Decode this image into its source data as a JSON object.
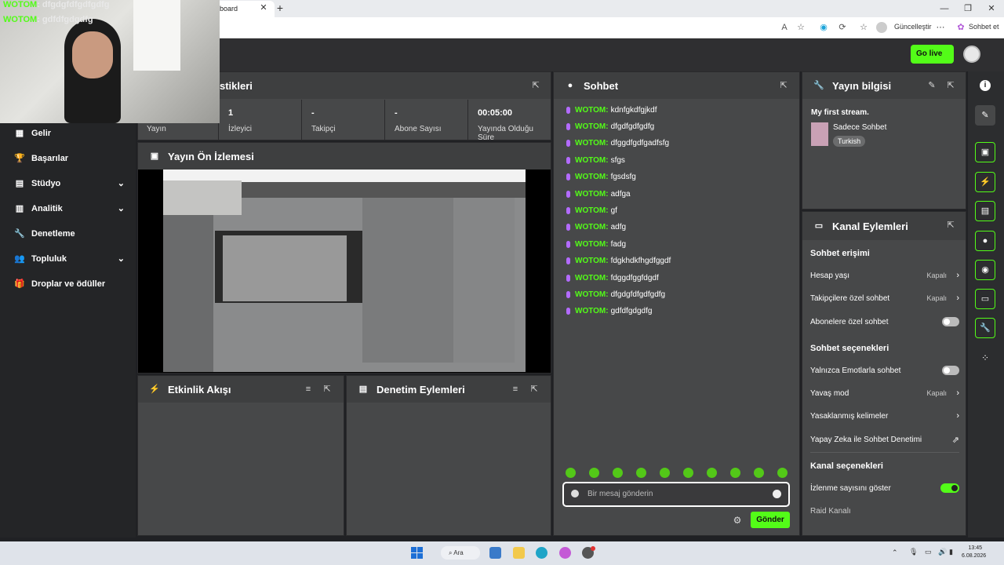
{
  "browser": {
    "tab_title": "board",
    "update_label": "Güncelleştir",
    "chat_label": "Sohbet et"
  },
  "header": {
    "golive_label": "Go live"
  },
  "sidebar": {
    "items": [
      {
        "label": "Gelir",
        "icon": "money-icon",
        "chevron": false
      },
      {
        "label": "Başarılar",
        "icon": "trophy-icon",
        "chevron": false
      },
      {
        "label": "Stüdyo",
        "icon": "studio-icon",
        "chevron": true
      },
      {
        "label": "Analitik",
        "icon": "analytics-icon",
        "chevron": true
      },
      {
        "label": "Denetleme",
        "icon": "wrench-icon",
        "chevron": false
      },
      {
        "label": "Topluluk",
        "icon": "community-icon",
        "chevron": true
      },
      {
        "label": "Droplar ve ödüller",
        "icon": "gift-icon",
        "chevron": false
      }
    ]
  },
  "stats": {
    "title": "stikleri",
    "cells": [
      {
        "value": "",
        "label": "Yayın"
      },
      {
        "value": "1",
        "label": "İzleyici"
      },
      {
        "value": "-",
        "label": "Takipçi"
      },
      {
        "value": "-",
        "label": "Abone Sayısı"
      },
      {
        "value": "00:05:00",
        "label": "Yayında Olduğu Süre"
      }
    ]
  },
  "preview": {
    "title": "Yayın Ön İzlemesi"
  },
  "activity": {
    "title": "Etkinlik Akışı"
  },
  "modlog": {
    "title": "Denetim Eylemleri"
  },
  "chat": {
    "title": "Sohbet",
    "messages": [
      {
        "user": "WOTOM:",
        "text": "kdnfgkdfgjkdf"
      },
      {
        "user": "WOTOM:",
        "text": "dfgdfgdfgdfg"
      },
      {
        "user": "WOTOM:",
        "text": "dfggdfgdfgadfsfg"
      },
      {
        "user": "WOTOM:",
        "text": "sfgs"
      },
      {
        "user": "WOTOM:",
        "text": "fgsdsfg"
      },
      {
        "user": "WOTOM:",
        "text": "adfga"
      },
      {
        "user": "WOTOM:",
        "text": "gf"
      },
      {
        "user": "WOTOM:",
        "text": "adfg"
      },
      {
        "user": "WOTOM:",
        "text": "fadg"
      },
      {
        "user": "WOTOM:",
        "text": "fdgkhdkfhgdfggdf"
      },
      {
        "user": "WOTOM:",
        "text": "fdggdfggfdgdf"
      },
      {
        "user": "WOTOM:",
        "text": "dfgdgfdfgdfgdfg"
      },
      {
        "user": "WOTOM:",
        "text": "gdfdfgdgdfg"
      }
    ],
    "input_placeholder": "Bir mesaj gönderin",
    "send_label": "Gönder"
  },
  "stream_info": {
    "title": "Yayın bilgisi",
    "stream_title": "My first stream.",
    "category": "Sadece Sohbet",
    "language_tag": "Turkish"
  },
  "channel_actions": {
    "title": "Kanal Eylemleri",
    "chat_access_heading": "Sohbet erişimi",
    "account_age_label": "Hesap yaşı",
    "account_age_value": "Kapalı",
    "followers_only_label": "Takipçilere özel sohbet",
    "followers_only_value": "Kapalı",
    "subscribers_only_label": "Abonelere özel sohbet",
    "chat_options_heading": "Sohbet seçenekleri",
    "emotes_only_label": "Yalnızca Emotlarla sohbet",
    "slow_mode_label": "Yavaş mod",
    "slow_mode_value": "Kapalı",
    "banned_words_label": "Yasaklanmış kelimeler",
    "ai_moderation_label": "Yapay Zeka ile Sohbet Denetimi",
    "channel_options_heading": "Kanal seçenekleri",
    "show_viewers_label": "İzlenme sayısını göster",
    "raid_label": "Raid Kanalı"
  },
  "overlay_chat": [
    {
      "user": "WOTOM",
      "text": ": dfgdgfdfgdfgdfg"
    },
    {
      "user": "WOTOM",
      "text": ": gdfdfgdgdfg"
    }
  ],
  "taskbar": {
    "search_label": "Ara",
    "time": "13:45",
    "date": "6.08.2026"
  },
  "colors": {
    "accent": "#53fc18",
    "panel": "#474849",
    "background": "#202124"
  }
}
